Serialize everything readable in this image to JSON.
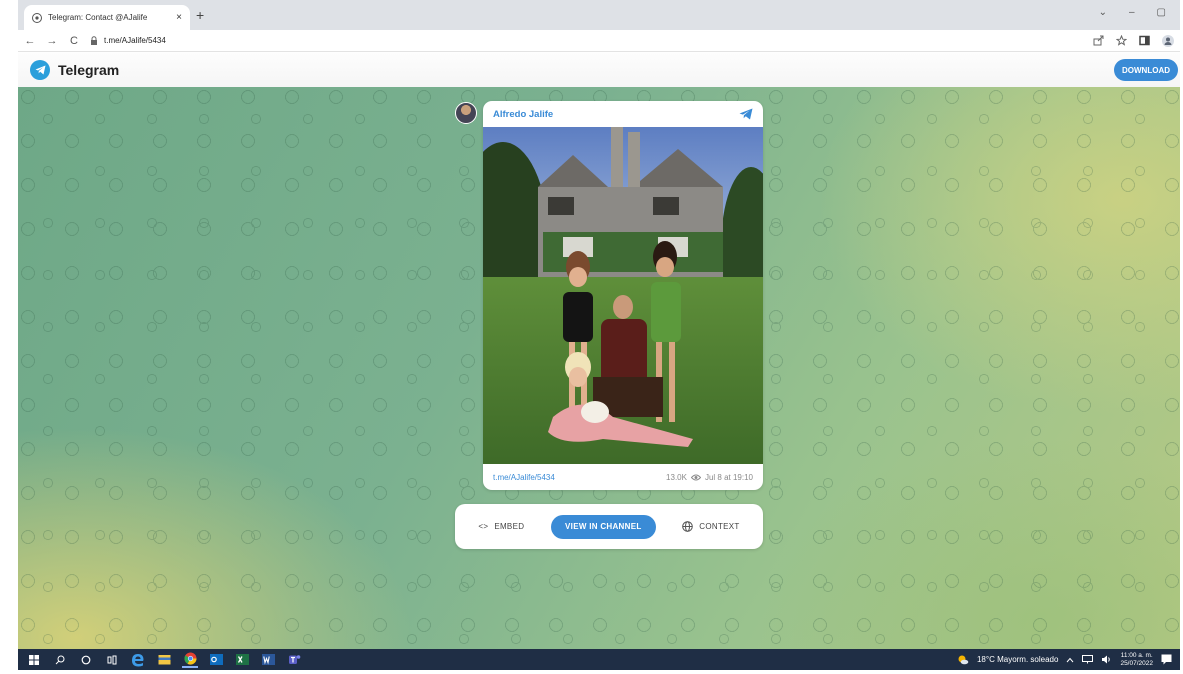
{
  "browser": {
    "tab_title": "Telegram: Contact @AJalife",
    "tab_close": "×",
    "new_tab": "+",
    "url": "t.me/AJalife/5434",
    "nav": {
      "back": "←",
      "forward": "→",
      "reload": "C"
    },
    "window_controls": {
      "dropdown": "⌄",
      "minimize": "–",
      "restore": "▢"
    }
  },
  "telegram_header": {
    "brand": "Telegram",
    "download_label": "DOWNLOAD"
  },
  "post": {
    "author": "Alfredo Jalife",
    "link": "t.me/AJalife/5434",
    "views": "13.0K",
    "date": "Jul 8 at 19:10"
  },
  "actions": {
    "embed": "EMBED",
    "embed_icon": "<>",
    "view_in_channel": "VIEW IN CHANNEL",
    "context": "CONTEXT"
  },
  "taskbar": {
    "weather": "18°C  Mayorm. soleado",
    "time": "11:00 a. m.",
    "date": "25/07/2022"
  },
  "colors": {
    "accent": "#3a8bd6",
    "telegram_logo": "#2b9fdb",
    "taskbar": "#1f2e45"
  },
  "icons": [
    "chrome-icon",
    "lock-icon",
    "share-icon",
    "star-icon",
    "sidepanel-icon",
    "profile-icon",
    "telegram-logo-icon",
    "telegram-plane-icon",
    "eye-icon",
    "globe-icon",
    "windows-start-icon",
    "search-icon",
    "cortana-icon",
    "task-view-icon",
    "edge-icon",
    "file-explorer-icon",
    "chrome-taskbar-icon",
    "outlook-icon",
    "excel-icon",
    "word-icon",
    "teams-icon",
    "weather-icon",
    "chevron-up-icon",
    "network-icon",
    "volume-icon",
    "notification-icon"
  ]
}
